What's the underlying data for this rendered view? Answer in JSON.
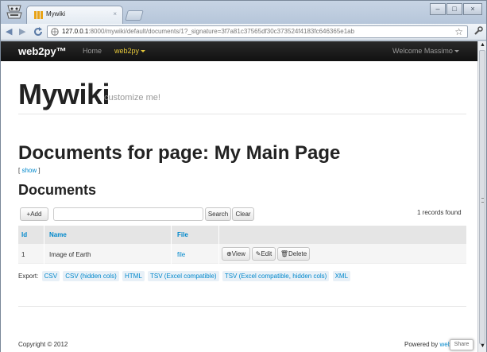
{
  "browser": {
    "tab_title": "Mywiki",
    "tab_close": "×",
    "url_host": "127.0.0.1",
    "url_rest": ":8000/mywiki/default/documents/1?_signature=3f7a81c37565df30c373524f4183fc646365e1ab",
    "star": "☆",
    "back": "◀",
    "forward": "▶",
    "minimize": "–",
    "maximize": "□",
    "close": "×"
  },
  "navbar": {
    "brand": "web2py™",
    "home": "Home",
    "web2py_menu": "web2py",
    "welcome": "Welcome Massimo"
  },
  "site": {
    "title": "Mywiki",
    "subtitle": "customize me!"
  },
  "page": {
    "heading": "Documents for page: My Main Page",
    "show_open": "[ ",
    "show_link": "show",
    "show_close": " ]",
    "subheading": "Documents"
  },
  "grid": {
    "add_label": "+Add",
    "search_label": "Search",
    "clear_label": "Clear",
    "records_count": "1 records found",
    "columns": [
      "Id",
      "Name",
      "File"
    ],
    "rows": [
      {
        "id": "1",
        "name": "Image of Earth",
        "file": "file",
        "view": "View",
        "edit": "Edit",
        "delete": "Delete"
      }
    ]
  },
  "export": {
    "label": "Export:",
    "links": [
      "CSV",
      "CSV (hidden cols)",
      "HTML",
      "TSV (Excel compatible)",
      "TSV (Excel compatible, hidden cols)",
      "XML"
    ]
  },
  "footer": {
    "copyright": "Copyright © 2012",
    "powered_prefix": "Powered by ",
    "powered_link": "web",
    "share": "Share"
  },
  "colors": {
    "link": "#0088cc",
    "navbar": "#1b1b1b",
    "accent_menu": "#e6c83a"
  }
}
